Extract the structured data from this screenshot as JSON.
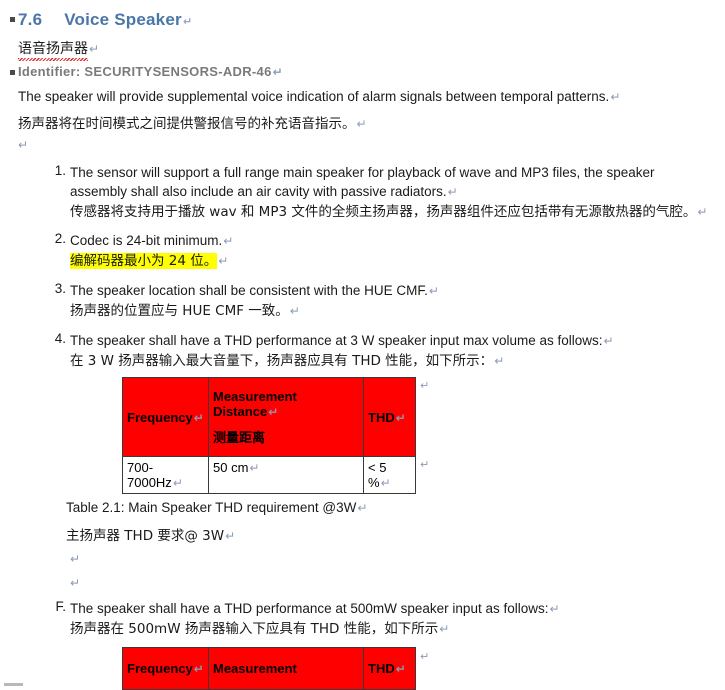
{
  "document": {
    "heading": {
      "number": "7.6",
      "title": "Voice Speaker",
      "pilcrow": "↵",
      "color": "#4a76a8"
    },
    "chinese_heading": {
      "text": "语音扬声器",
      "pilcrow": "↵",
      "spellcheck_underline_color": "#e03131"
    },
    "identifier": {
      "label": "Identifier: SECURITYSENSORS-ADR-46",
      "pilcrow": "↵",
      "color": "#7a7a7a"
    },
    "intro": {
      "english": "The speaker will provide supplemental voice indication of alarm signals between temporal patterns.",
      "english_pilcrow": "↵",
      "chinese": "扬声器将在时间模式之间提供警报信号的补充语音指示。",
      "chinese_pilcrow": "↵",
      "empty_mark": "↵"
    },
    "list": [
      {
        "marker": "1.",
        "english": "The sensor will support a full range main speaker for playback of wave and MP3 files, the speaker assembly shall also include an air cavity with passive radiators.",
        "english_pilcrow": "↵",
        "chinese": "传感器将支持用于播放 wav 和 MP3 文件的全频主扬声器，扬声器组件还应包括带有无源散热器的气腔。",
        "chinese_pilcrow": "↵",
        "highlighted": false
      },
      {
        "marker": "2.",
        "english": "Codec is 24-bit minimum.",
        "english_pilcrow": "↵",
        "chinese": "编解码器最小为 24 位。",
        "chinese_pilcrow": "↵",
        "highlighted": true,
        "highlight_color": "#ffff00"
      },
      {
        "marker": "3.",
        "english": "The speaker location shall be consistent with the HUE CMF.",
        "english_pilcrow": "↵",
        "chinese": "扬声器的位置应与 HUE CMF 一致。",
        "chinese_pilcrow": "↵",
        "highlighted": false
      },
      {
        "marker": "4.",
        "english": "The speaker shall have a THD performance at 3 W speaker input max volume as follows:",
        "english_pilcrow": "↵",
        "chinese": "在 3 W 扬声器输入最大音量下，扬声器应具有 THD 性能，如下所示：",
        "chinese_pilcrow": "↵",
        "highlighted": false
      }
    ],
    "table_1": {
      "header_bg": "#ff0000",
      "headers": [
        {
          "text": "Frequency",
          "pilcrow": "↵",
          "line2": "",
          "chinese": ""
        },
        {
          "text": "Measurement",
          "pilcrow": "↵",
          "line2": "Distance",
          "chinese": "测量距离"
        },
        {
          "text": "THD",
          "pilcrow": "↵",
          "line2": "",
          "chinese": ""
        }
      ],
      "rows": [
        [
          {
            "text": "700-7000Hz",
            "pilcrow": "↵"
          },
          {
            "text": "50 cm",
            "pilcrow": "↵"
          },
          {
            "text": "< 5 %",
            "pilcrow": "↵"
          }
        ]
      ],
      "row_end_marks": [
        "↵",
        "↵"
      ]
    },
    "caption_1": {
      "english": "Table 2.1: Main Speaker THD requirement @3W",
      "english_pilcrow": "↵",
      "chinese": "主扬声器 THD 要求@ 3W",
      "chinese_pilcrow": "↵"
    },
    "blank_marks": [
      "↵",
      "↵"
    ],
    "item_f": {
      "marker": "F.",
      "english": "The speaker shall have a THD performance at 500mW speaker input as follows:",
      "english_pilcrow": "↵",
      "chinese": "扬声器在 500mW 扬声器输入下应具有 THD 性能，如下所示",
      "chinese_pilcrow": "↵"
    },
    "table_2": {
      "header_bg": "#ff0000",
      "headers": [
        {
          "text": "Frequency",
          "pilcrow": "↵"
        },
        {
          "text": "Measurement",
          "pilcrow": ""
        },
        {
          "text": "THD",
          "pilcrow": "↵"
        }
      ],
      "row_end_mark": "↵"
    }
  }
}
